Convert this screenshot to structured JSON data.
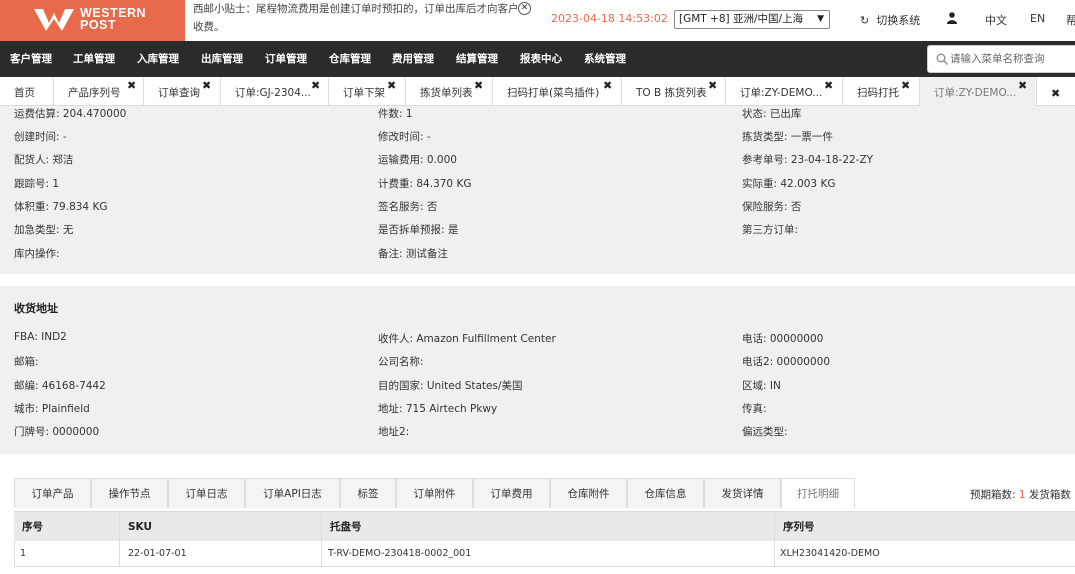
{
  "header": {
    "logo_line1": "WESTERN",
    "logo_line2": "POST",
    "tip": "西邮小贴士：尾程物流费用是创建订单时预扣的，订单出库后才向客户收费。",
    "datetime": "2023-04-18 14:53:02",
    "timezone": "[GMT +8] 亚洲/中国/上海",
    "switch_system": "切换系统",
    "lang_zh": "中文",
    "lang_en": "EN",
    "lang_more": "帮"
  },
  "nav": {
    "items": [
      "客户管理",
      "工单管理",
      "入库管理",
      "出库管理",
      "订单管理",
      "仓库管理",
      "费用管理",
      "结算管理",
      "报表中心",
      "系统管理"
    ],
    "search_placeholder": "请输入菜单名称查询"
  },
  "tabs": [
    {
      "label": "首页",
      "closable": false
    },
    {
      "label": "产品序列号",
      "closable": true
    },
    {
      "label": "订单查询",
      "closable": true
    },
    {
      "label": "订单:GJ-2304...",
      "closable": true
    },
    {
      "label": "订单下架",
      "closable": true
    },
    {
      "label": "拣货单列表",
      "closable": true
    },
    {
      "label": "扫码打单(菜鸟插件)",
      "closable": true
    },
    {
      "label": "TO B 拣货列表",
      "closable": true
    },
    {
      "label": "订单:ZY-DEMO...",
      "closable": true
    },
    {
      "label": "扫码打托",
      "closable": true
    },
    {
      "label": "订单:ZY-DEMO...",
      "closable": true
    }
  ],
  "order_info": {
    "col1": [
      "运费估算: 204.470000",
      "创建时间: -",
      "配货人: 郑洁",
      "跟踪号: 1",
      "体积重: 79.834 KG",
      "加急类型: 无",
      "库内操作:"
    ],
    "col2": [
      "件数: 1",
      "修改时间: -",
      "运输费用: 0.000",
      "计费重: 84.370 KG",
      "签名服务: 否",
      "是否拆单预报: 是",
      "备注:   测试备注"
    ],
    "col3": [
      "状态: 已出库",
      "拣货类型: 一票一件",
      "参考单号: 23-04-18-22-ZY",
      "实际重: 42.003 KG",
      "保险服务: 否",
      "第三方订单:"
    ]
  },
  "address": {
    "title": "收货地址",
    "col1": [
      "FBA: IND2",
      "邮箱:",
      "邮编: 46168-7442",
      "城市: Plainfield",
      "门牌号: 0000000"
    ],
    "col2": [
      "收件人: Amazon Fulfillment Center",
      "公司名称:",
      "目的国家: United States/美国",
      "地址: 715 Airtech Pkwy",
      "地址2:"
    ],
    "col3": [
      "电话: 00000000",
      "电话2: 00000000",
      "区域: IN",
      "传真:",
      "偏远类型:"
    ]
  },
  "bottom_tabs": [
    "订单产品",
    "操作节点",
    "订单日志",
    "订单API日志",
    "标签",
    "订单附件",
    "订单费用",
    "仓库附件",
    "仓库信息",
    "发货详情",
    "打托明细"
  ],
  "stats": {
    "label": "预期箱数:",
    "value": "1",
    "label2": "发货箱数"
  },
  "table": {
    "headers": [
      "序号",
      "SKU",
      "托盘号",
      "序列号"
    ],
    "rows": [
      [
        "1",
        "22-01-07-01",
        "T-RV-DEMO-230418-0002_001",
        "XLH23041420-DEMO"
      ]
    ]
  },
  "colors": {
    "accent": "#e86a4a",
    "nav_bg": "#2b2b2b"
  }
}
